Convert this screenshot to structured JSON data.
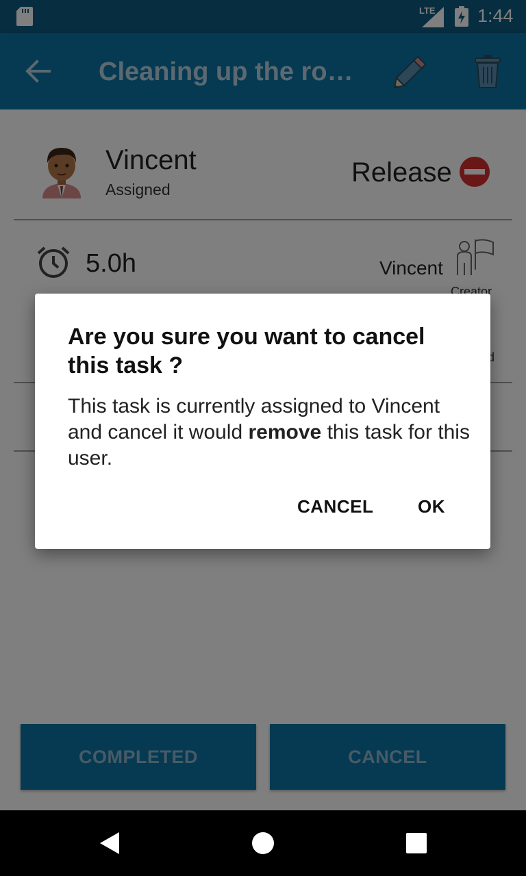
{
  "status_bar": {
    "time": "1:44",
    "network": "LTE"
  },
  "app_bar": {
    "title": "Cleaning up the room",
    "back_icon": "arrow-back-icon",
    "edit_icon": "pencil-icon",
    "delete_icon": "trash-icon"
  },
  "assignee": {
    "name": "Vincent",
    "status": "Assigned",
    "release_label": "Release"
  },
  "task": {
    "duration": "5.0h",
    "creator_name": "Vincent",
    "creator_label": "Creator",
    "hidden_label_partial": "d"
  },
  "bottom_buttons": {
    "completed": "COMPLETED",
    "cancel": "CANCEL"
  },
  "dialog": {
    "title": "Are you sure you want to cancel this task ?",
    "message_before": "This task is currently assigned to Vincent and cancel it would ",
    "message_bold": "remove",
    "message_after": " this task for this user.",
    "cancel_label": "CANCEL",
    "ok_label": "OK"
  },
  "colors": {
    "primary": "#0c74a6",
    "primary_dark": "#0c5a80",
    "release_red": "#d32f2f"
  }
}
